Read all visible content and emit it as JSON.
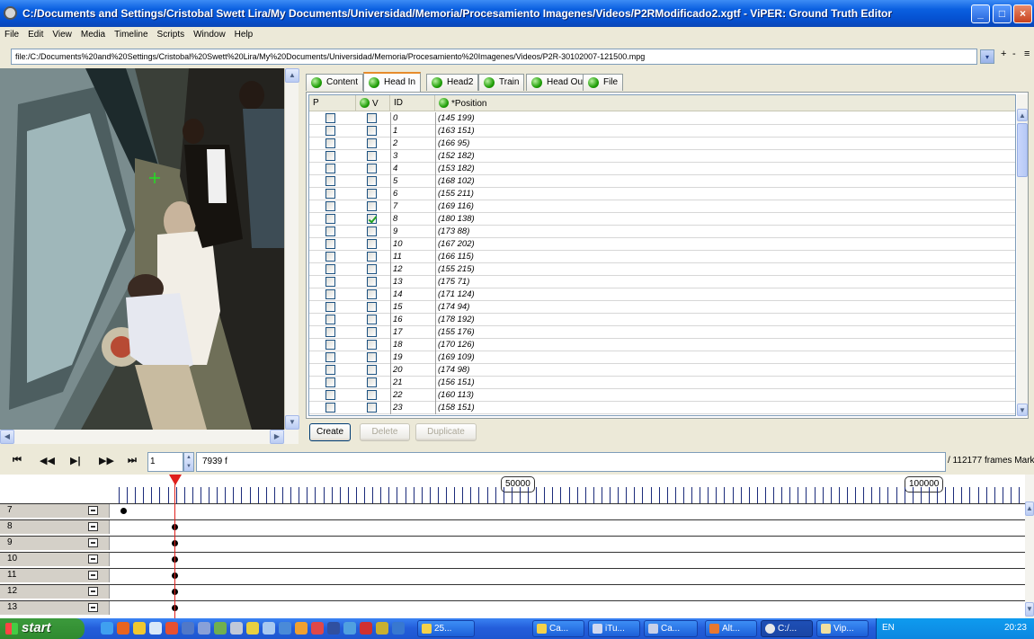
{
  "window": {
    "title": "C:/Documents and Settings/Cristobal Swett Lira/My Documents/Universidad/Memoria/Procesamiento Imagenes/Videos/P2RModificado2.xgtf - ViPER: Ground Truth Editor",
    "minimize": "_",
    "maximize": "□",
    "close": "×"
  },
  "menu": [
    "File",
    "Edit",
    "View",
    "Media",
    "Timeline",
    "Scripts",
    "Window",
    "Help"
  ],
  "url": {
    "value": "file:/C:/Documents%20and%20Settings/Cristobal%20Swett%20Lira/My%20Documents/Universidad/Memoria/Procesamiento%20Imagenes/Videos/P2R-30102007-121500.mpg",
    "dropdown": "▾",
    "plus": "+",
    "minus": "-",
    "more": "≡"
  },
  "tabs": [
    {
      "label": "Content",
      "active": false
    },
    {
      "label": "Head In",
      "active": true
    },
    {
      "label": "Head2",
      "active": false
    },
    {
      "label": "Train",
      "active": false
    },
    {
      "label": "Head Out",
      "active": false
    },
    {
      "label": "File",
      "active": false
    }
  ],
  "table": {
    "columns": {
      "p": "P",
      "v": "V",
      "id": "ID",
      "position": "*Position"
    },
    "rows": [
      {
        "id": "0",
        "pos": "(145 199)",
        "v": false
      },
      {
        "id": "1",
        "pos": "(163 151)",
        "v": false
      },
      {
        "id": "2",
        "pos": "(166 95)",
        "v": false
      },
      {
        "id": "3",
        "pos": "(152 182)",
        "v": false
      },
      {
        "id": "4",
        "pos": "(153 182)",
        "v": false
      },
      {
        "id": "5",
        "pos": "(168 102)",
        "v": false
      },
      {
        "id": "6",
        "pos": "(155 211)",
        "v": false
      },
      {
        "id": "7",
        "pos": "(169 116)",
        "v": false
      },
      {
        "id": "8",
        "pos": "(180 138)",
        "v": true
      },
      {
        "id": "9",
        "pos": "(173 88)",
        "v": false
      },
      {
        "id": "10",
        "pos": "(167 202)",
        "v": false
      },
      {
        "id": "11",
        "pos": "(166 115)",
        "v": false
      },
      {
        "id": "12",
        "pos": "(155 215)",
        "v": false
      },
      {
        "id": "13",
        "pos": "(175 71)",
        "v": false
      },
      {
        "id": "14",
        "pos": "(171 124)",
        "v": false
      },
      {
        "id": "15",
        "pos": "(174 94)",
        "v": false
      },
      {
        "id": "16",
        "pos": "(178 192)",
        "v": false
      },
      {
        "id": "17",
        "pos": "(155 176)",
        "v": false
      },
      {
        "id": "18",
        "pos": "(170 126)",
        "v": false
      },
      {
        "id": "19",
        "pos": "(169 109)",
        "v": false
      },
      {
        "id": "20",
        "pos": "(174 98)",
        "v": false
      },
      {
        "id": "21",
        "pos": "(156 151)",
        "v": false
      },
      {
        "id": "22",
        "pos": "(160 113)",
        "v": false
      },
      {
        "id": "23",
        "pos": "(158 151)",
        "v": false
      }
    ]
  },
  "buttons": {
    "create": "Create",
    "delete": "Delete",
    "duplicate": "Duplicate"
  },
  "playback": {
    "first": "⏮",
    "prev": "◀◀",
    "step": "▶|",
    "next": "▶▶",
    "last": "⏭",
    "frame_input": "1",
    "current_frame": "7939 f",
    "total": "/ 112177 frames Mark"
  },
  "timeline": {
    "labels": [
      "50000",
      "100000"
    ],
    "rows": [
      "7",
      "8",
      "9",
      "10",
      "11",
      "12",
      "13"
    ]
  },
  "taskbar": {
    "start": "start",
    "tasks": [
      "25...",
      "Ca...",
      "iTu...",
      "Ca...",
      "Alt...",
      "C:/...",
      "Vip..."
    ],
    "lang": "EN",
    "clock": "20:23"
  },
  "colors": {
    "accent": "#0a5fe0",
    "tab_active_border": "#e68b2c",
    "marker": "#e0201c",
    "status_green": "#22a00a"
  }
}
